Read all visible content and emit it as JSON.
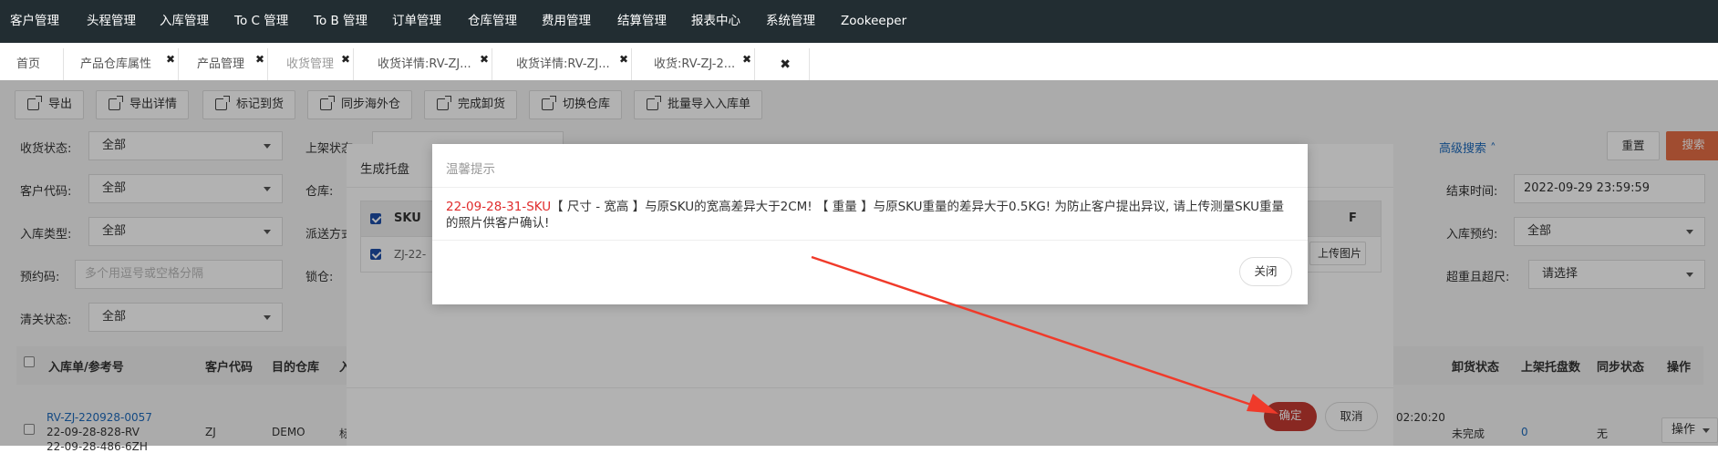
{
  "topnav": {
    "items": [
      "客户管理",
      "头程管理",
      "入库管理",
      "To C 管理",
      "To B 管理",
      "订单管理",
      "仓库管理",
      "费用管理",
      "结算管理",
      "报表中心",
      "系统管理",
      "Zookeeper"
    ]
  },
  "tabs": [
    {
      "label": "首页",
      "closable": false
    },
    {
      "label": "产品仓库属性",
      "closable": true
    },
    {
      "label": "产品管理",
      "closable": true
    },
    {
      "label": "收货管理",
      "closable": true,
      "active": true
    },
    {
      "label": "收货详情:RV-ZJ...",
      "closable": true
    },
    {
      "label": "收货详情:RV-ZJ...",
      "closable": true
    },
    {
      "label": "收货:RV-ZJ-2...",
      "closable": true
    }
  ],
  "toolbar": {
    "buttons": [
      "导出",
      "导出详情",
      "标记到货",
      "同步海外仓",
      "完成卸货",
      "切换仓库",
      "批量导入入库单"
    ]
  },
  "filters": {
    "receive_status_label": "收货状态:",
    "receive_status_value": "全部",
    "shelf_status_label": "上架状态",
    "customer_code_label": "客户代码:",
    "customer_code_value": "全部",
    "warehouse_label": "仓库:",
    "inbound_type_label": "入库类型:",
    "inbound_type_value": "全部",
    "dispatch_label": "派送方式",
    "booking_code_label": "预约码:",
    "booking_code_placeholder": "多个用逗号或空格分隔",
    "lock_label": "锁仓:",
    "clearance_label": "清关状态:",
    "clearance_value": "全部",
    "advanced_search": "高级搜索",
    "reset": "重置",
    "search": "搜索",
    "end_time_label": "结束时间:",
    "end_time_value": "2022-09-29 23:59:59",
    "inbound_booking_label": "入库预约:",
    "inbound_booking_value": "全部",
    "overweight_label": "超重且超尺:",
    "overweight_value": "请选择"
  },
  "table": {
    "headers": [
      "入库单/参考号",
      "客户代码",
      "目的仓库",
      "入",
      "卸货状态",
      "上架托盘数",
      "同步状态",
      "操作"
    ],
    "row": {
      "order_no": "RV-ZJ-220928-0057",
      "ref1": "22-09-28-828-RV",
      "ref2": "22-09-28-486-6ZH",
      "customer": "ZJ",
      "warehouse": "DEMO",
      "col4": "标",
      "time": "02:20:20",
      "unload": "未完成",
      "pallets": "0",
      "sync": "无",
      "action": "操作"
    }
  },
  "pallet_dialog": {
    "title": "生成托盘",
    "col_sku": "SKU",
    "row_sku": "ZJ-22-",
    "upload": "上传图片",
    "col_f": "F",
    "confirm": "确定",
    "cancel": "取消"
  },
  "alert": {
    "title": "温馨提示",
    "code": "22-09-28-31-SKU",
    "message": "【 尺寸 - 宽高 】与原SKU的宽高差异大于2CM! 【 重量 】与原SKU重量的差异大于0.5KG! 为防止客户提出异议, 请上传测量SKU重量的照片供客户确认!",
    "close": "关闭"
  },
  "colors": {
    "topnav_bg": "#222d32",
    "search_btn": "#e66e46",
    "link": "#1e6abc",
    "danger": "#e02c2c",
    "confirm_btn": "#c43a32",
    "arrow": "#f03a2a"
  }
}
